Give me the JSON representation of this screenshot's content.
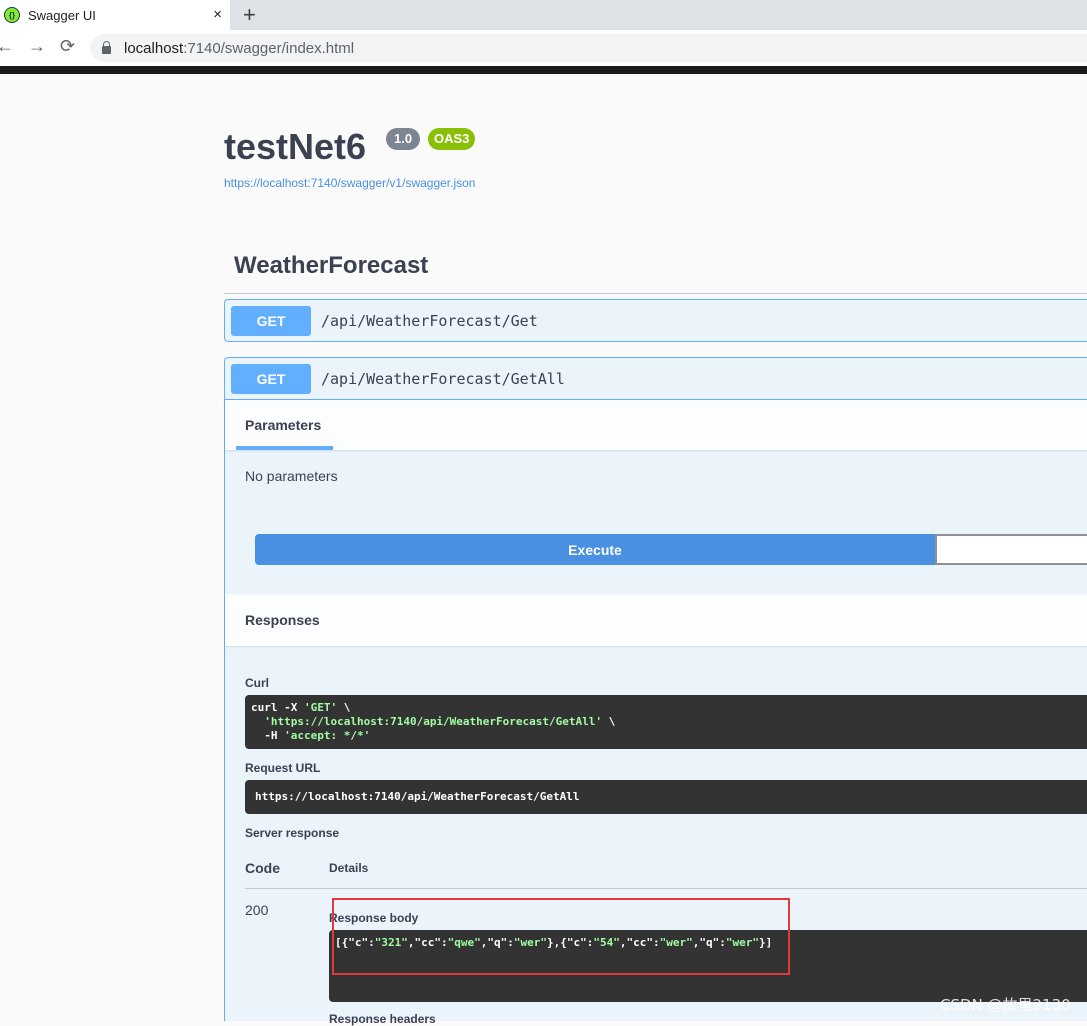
{
  "browser": {
    "tab_title": "Swagger UI",
    "tab_close": "×",
    "new_tab": "+",
    "url_host": "localhost",
    "url_path": ":7140/swagger/index.html",
    "nav_back": "←",
    "nav_forward": "→",
    "nav_reload": "⟳",
    "favicon": "{}"
  },
  "info": {
    "title": "testNet6",
    "version": "1.0",
    "oas": "OAS3",
    "spec_url": "https://localhost:7140/swagger/v1/swagger.json"
  },
  "tag": {
    "name": "WeatherForecast"
  },
  "operations": [
    {
      "method": "GET",
      "path": "/api/WeatherForecast/Get"
    },
    {
      "method": "GET",
      "path": "/api/WeatherForecast/GetAll"
    }
  ],
  "expanded": {
    "parameters_tab": "Parameters",
    "no_parameters": "No parameters",
    "execute_label": "Execute",
    "responses_title": "Responses",
    "curl_label": "Curl",
    "curl_line1_cmd": "curl -X ",
    "curl_line1_method": "'GET'",
    "curl_line1_end": " \\",
    "curl_line2_url": "'https://localhost:7140/api/WeatherForecast/GetAll'",
    "curl_line2_end": " \\",
    "curl_line3_flag": "-H ",
    "curl_line3_header": "'accept: */*'",
    "request_url_label": "Request URL",
    "request_url": "https://localhost:7140/api/WeatherForecast/GetAll",
    "server_response_label": "Server response",
    "code_header": "Code",
    "details_header": "Details",
    "status_code": "200",
    "response_body_label": "Response body",
    "response_body_parts": [
      {
        "t": "[{\"c\":",
        "s": false
      },
      {
        "t": "\"321\"",
        "s": true
      },
      {
        "t": ",\"cc\":",
        "s": false
      },
      {
        "t": "\"qwe\"",
        "s": true
      },
      {
        "t": ",\"q\":",
        "s": false
      },
      {
        "t": "\"wer\"",
        "s": true
      },
      {
        "t": "},{\"c\":",
        "s": false
      },
      {
        "t": "\"54\"",
        "s": true
      },
      {
        "t": ",\"cc\":",
        "s": false
      },
      {
        "t": "\"wer\"",
        "s": true
      },
      {
        "t": ",\"q\":",
        "s": false
      },
      {
        "t": "\"wer\"",
        "s": true
      },
      {
        "t": "}]",
        "s": false
      }
    ],
    "response_headers_label": "Response headers"
  },
  "watermark": "CSDN @故里2130",
  "colors": {
    "get": "#61affe",
    "execute": "#4990e2",
    "oas_badge": "#89bf04",
    "highlight": "#e03a3a"
  }
}
